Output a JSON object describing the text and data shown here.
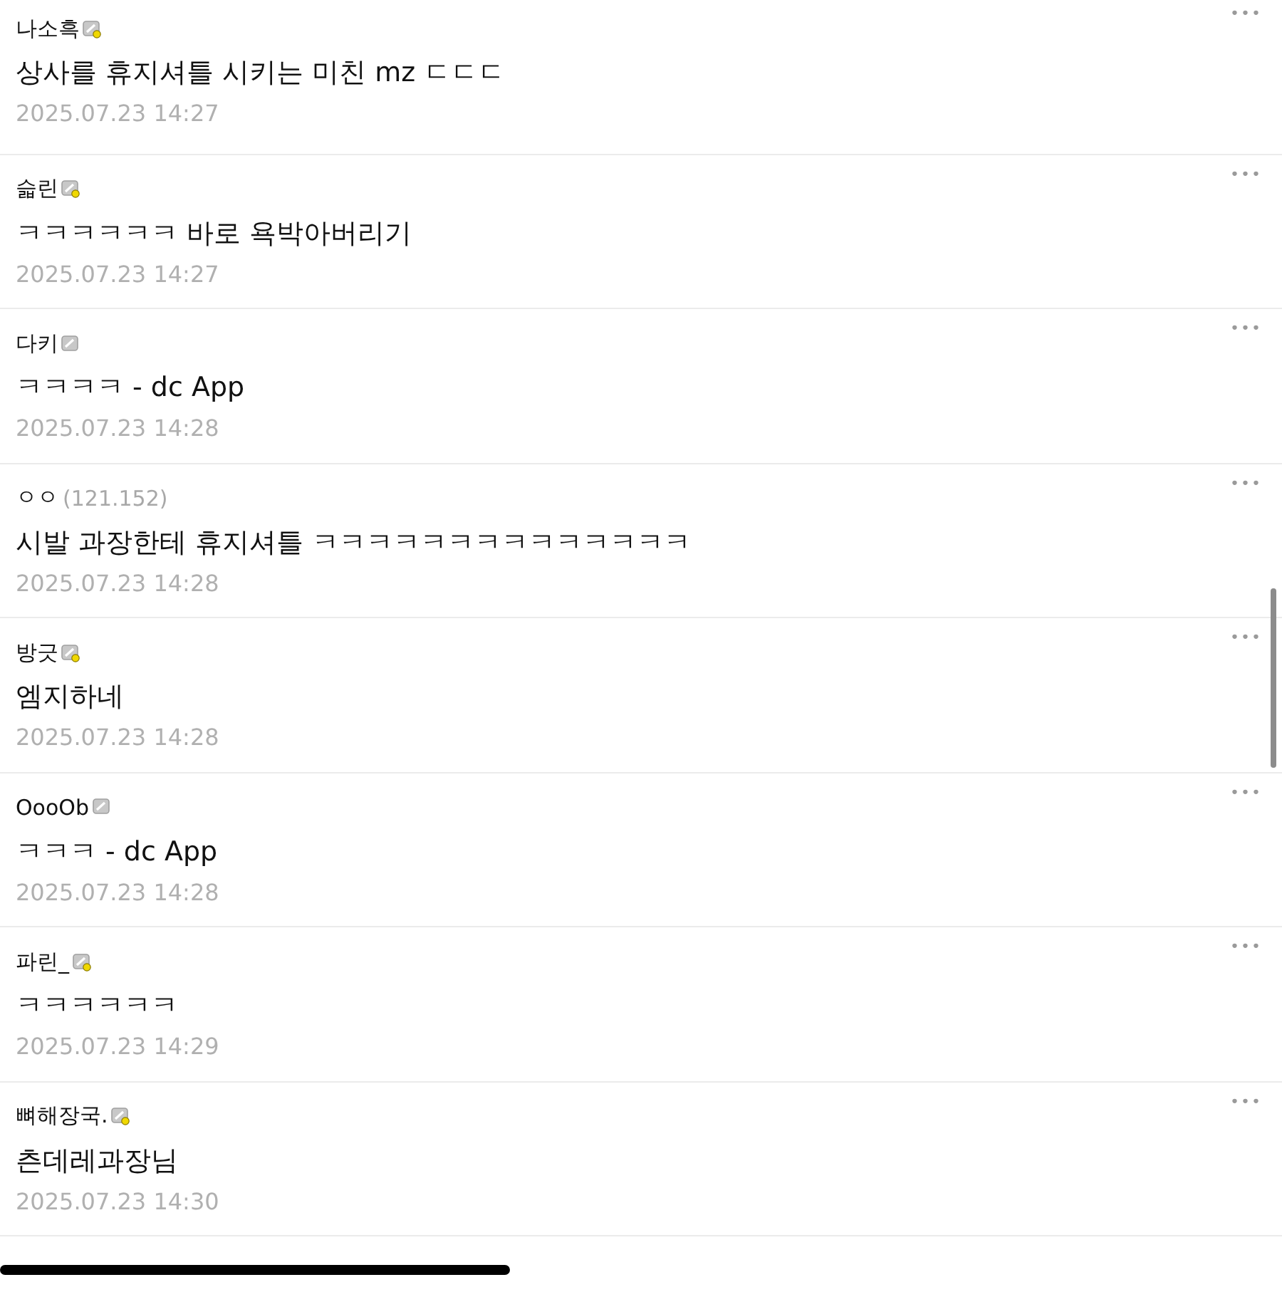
{
  "comments": [
    {
      "author": "나소흑",
      "kind": "fixed",
      "text": "상사를 휴지셔틀 시키는 미친 mz ㄷㄷㄷ",
      "time": "2025.07.23 14:27",
      "menu": "•••"
    },
    {
      "author": "슯린",
      "kind": "fixed",
      "text": "ㅋㅋㅋㅋㅋㅋ 바로 욕박아버리기",
      "time": "2025.07.23 14:27",
      "menu": "•••"
    },
    {
      "author": "다키",
      "kind": "semi",
      "text": "ㅋㅋㅋㅋ - dc App",
      "time": "2025.07.23 14:28",
      "menu": "•••"
    },
    {
      "author": "ㅇㅇ",
      "kind": "guest",
      "ip": "(121.152)",
      "text": "시발 과장한테 휴지셔틀 ㅋㅋㅋㅋㅋㅋㅋㅋㅋㅋㅋㅋㅋㅋ",
      "time": "2025.07.23 14:28",
      "menu": "•••"
    },
    {
      "author": "방긋",
      "kind": "fixed",
      "text": "엠지하네",
      "time": "2025.07.23 14:28",
      "menu": "•••"
    },
    {
      "author": "OooOb",
      "kind": "semi",
      "text": "ㅋㅋㅋ - dc App",
      "time": "2025.07.23 14:28",
      "menu": "•••"
    },
    {
      "author": "파린_",
      "kind": "fixed",
      "text": "ㅋㅋㅋㅋㅋㅋ",
      "time": "2025.07.23 14:29",
      "menu": "•••"
    },
    {
      "author": "뼈해장국.",
      "kind": "fixed",
      "text": "츤데레과장님",
      "time": "2025.07.23 14:30",
      "menu": "•••"
    }
  ]
}
